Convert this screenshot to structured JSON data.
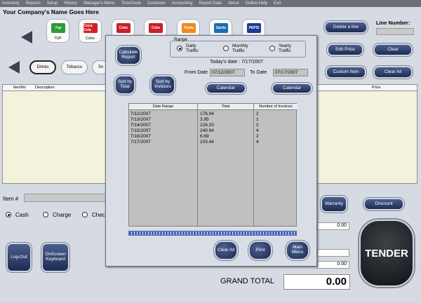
{
  "menu": [
    "Inventory",
    "Reports",
    "Setup",
    "History",
    "Manager's Menu",
    "TimeClock",
    "Customer",
    "Accounting",
    "Report Data",
    "About",
    "Online-Help",
    "Exit"
  ],
  "company_name": "Your Company's Name Goes Here",
  "products": [
    {
      "label": "7UP",
      "logo": "7up",
      "color": "#2e9a3c"
    },
    {
      "label": "Coke",
      "logo": "Coca-Cola",
      "color": "#d21f26"
    },
    {
      "label": "",
      "logo": "Coke",
      "color": "#c8202a"
    },
    {
      "label": "",
      "logo": "Coke",
      "color": "#c8202a"
    },
    {
      "label": "",
      "logo": "Fanta",
      "color": "#f08a1c"
    },
    {
      "label": "",
      "logo": "Sprite",
      "color": "#1d6bb3"
    },
    {
      "label": "",
      "logo": "PEPSI",
      "color": "#1a3c8f"
    }
  ],
  "categories": [
    "Drinks",
    "Tobacco",
    "Sn"
  ],
  "right_buttons": {
    "delete_line": "Delete a line",
    "line_number_label": "Line Number:",
    "edit_price": "Edit Price",
    "clear": "Clear",
    "custom_item": "Custom Item",
    "clear_all": "Clear All"
  },
  "grid": {
    "col_itemno": "ItemNo",
    "col_description": "Description",
    "col_price": "Price"
  },
  "item_label": "Item #",
  "payment": {
    "cash": "Cash",
    "charge": "Charge",
    "check": "Chec"
  },
  "warranty": "Warranty",
  "discount": "Discount",
  "amount_1": "0.00",
  "amount_2": "0.00",
  "logout": "Log-Out",
  "onscreen_keyboard": "OnScreen Keyboard",
  "tender": "TENDER",
  "grand_total_label": "GRAND TOTAL",
  "currency": "$",
  "grand_total": "0.00",
  "dialog": {
    "calculate_report": "Calculate Report",
    "range_label": "Range",
    "range_daily": "Daily Traffic",
    "range_monthly": "Monthly Traffic",
    "range_yearly": "Yearly Traffic",
    "todays_date": "Today's date : 7/17/2007",
    "sort_total": "Sort by Total",
    "sort_invoices": "Sort by Invoices",
    "from_date_label": "From Date",
    "from_date": "07/12/2007",
    "to_date_label": "To Date",
    "to_date": "07/17/2007",
    "calendar_1": "Calendar",
    "calendar_2": "Calendar",
    "table_headers": [
      "Date Range",
      "Total",
      "Number of Invoices"
    ],
    "rows": [
      {
        "date": "7/12/2007",
        "total": "176.94",
        "invoices": "2"
      },
      {
        "date": "7/13/2007",
        "total": "3.95",
        "invoices": "1"
      },
      {
        "date": "7/14/2007",
        "total": "226.20",
        "invoices": "2"
      },
      {
        "date": "7/15/2007",
        "total": "240.94",
        "invoices": "4"
      },
      {
        "date": "7/16/2007",
        "total": "6.69",
        "invoices": "2"
      },
      {
        "date": "7/17/2007",
        "total": "103.44",
        "invoices": "4"
      }
    ],
    "clear_all": "Clear All",
    "print": "Print",
    "main_menu": "Main Menu"
  }
}
